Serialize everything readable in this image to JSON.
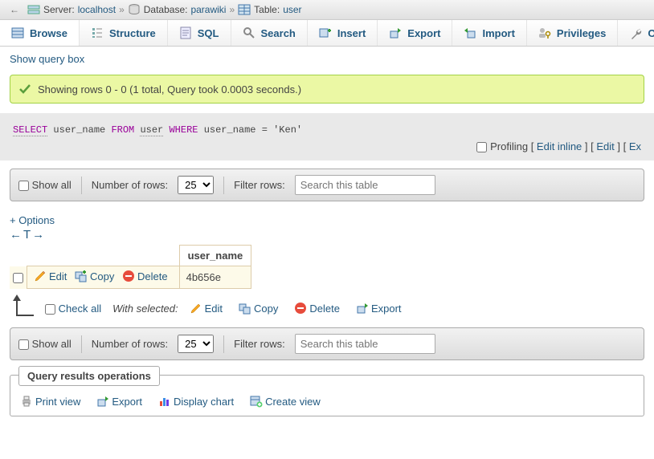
{
  "breadcrumb": {
    "server_label": "Server:",
    "server": "localhost",
    "db_label": "Database:",
    "db": "parawiki",
    "table_label": "Table:",
    "table": "user"
  },
  "tabs": {
    "browse": "Browse",
    "structure": "Structure",
    "sql": "SQL",
    "search": "Search",
    "insert": "Insert",
    "export": "Export",
    "import": "Import",
    "privileges": "Privileges",
    "operations": "Opera"
  },
  "show_query_box": "Show query box",
  "success_msg": "Showing rows 0 - 0 (1 total, Query took 0.0003 seconds.)",
  "sql_tokens": {
    "select": "SELECT",
    "col": "user_name",
    "from": "FROM",
    "table": "user",
    "where": "WHERE",
    "cond": "user_name = 'Ken'"
  },
  "sql_actions": {
    "profiling": "Profiling",
    "edit_inline": "Edit inline",
    "edit": "Edit",
    "explain": "Ex"
  },
  "navbar": {
    "show_all": "Show all",
    "num_rows_label": "Number of rows:",
    "num_rows_value": "25",
    "filter_label": "Filter rows:",
    "filter_placeholder": "Search this table"
  },
  "options_link": "+ Options",
  "table": {
    "header": "user_name",
    "row": {
      "edit": "Edit",
      "copy": "Copy",
      "delete": "Delete",
      "value": "4b656e"
    }
  },
  "checkall": {
    "label": "Check all",
    "with_selected": "With selected:",
    "edit": "Edit",
    "copy": "Copy",
    "delete": "Delete",
    "export": "Export"
  },
  "ops": {
    "legend": "Query results operations",
    "print": "Print view",
    "export": "Export",
    "chart": "Display chart",
    "create_view": "Create view"
  }
}
